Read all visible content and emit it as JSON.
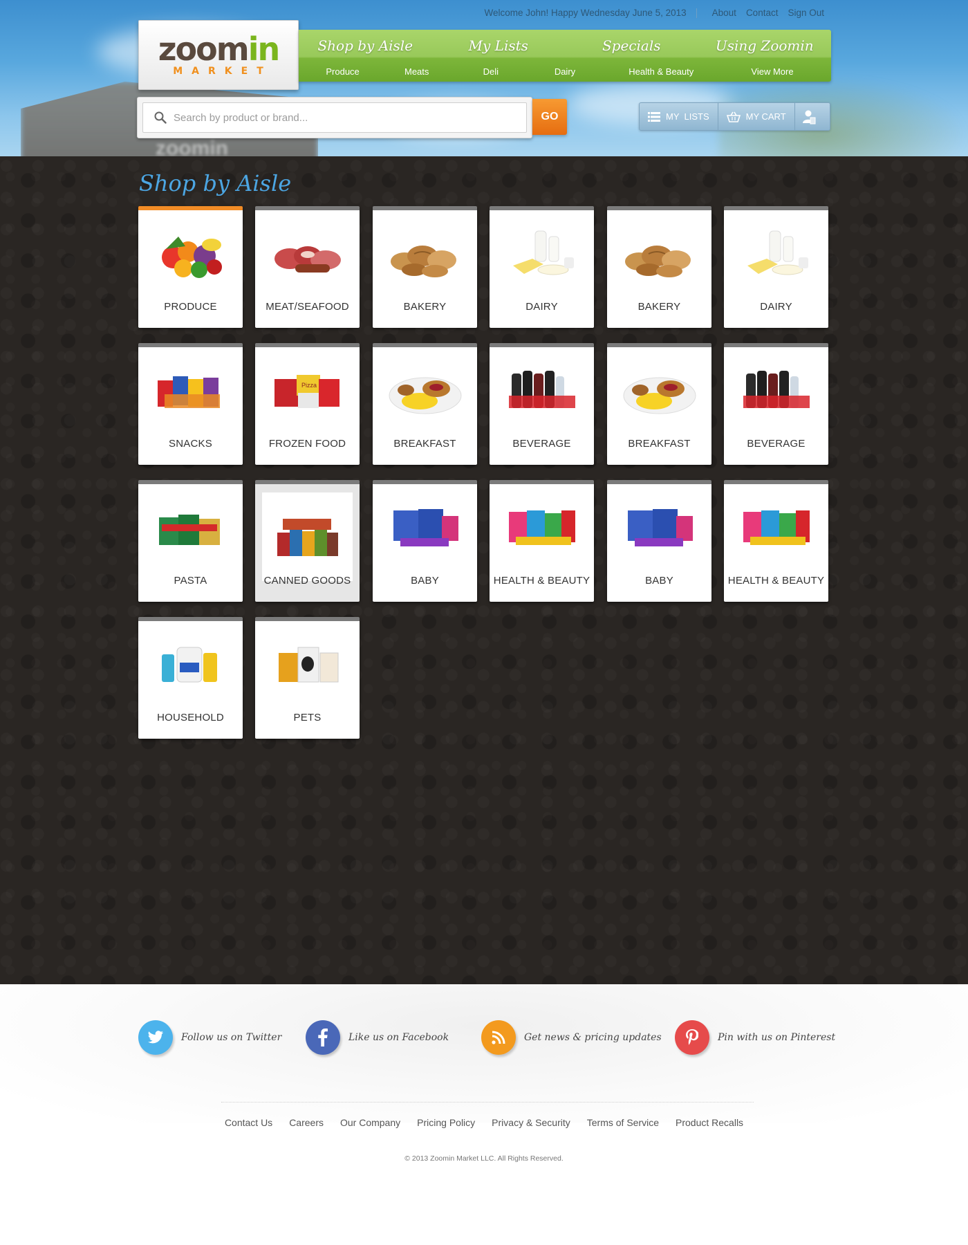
{
  "topbar": {
    "welcome": "Welcome John! Happy Wednesday June 5, 2013",
    "links": [
      "About",
      "Contact",
      "Sign Out"
    ]
  },
  "logo": {
    "word_main": "zoom",
    "word_accent": "in",
    "sub": "MARKET",
    "colors": {
      "brown": "#5a4a3e",
      "green": "#7ab51d",
      "orange": "#f0901e"
    }
  },
  "nav": {
    "primary": [
      "Shop by Aisle",
      "My Lists",
      "Specials",
      "Using Zoomin"
    ],
    "secondary": [
      "Produce",
      "Meats",
      "Deli",
      "Dairy",
      "Health & Beauty",
      "View More"
    ]
  },
  "search": {
    "placeholder": "Search by product or brand...",
    "go_label": "GO",
    "icon": "search-icon"
  },
  "utility": {
    "lists_label": "MY  LISTS",
    "cart_label": "MY CART",
    "lists_icon": "list-icon",
    "cart_icon": "basket-icon",
    "account_icon": "user-icon"
  },
  "main": {
    "title": "Shop by Aisle",
    "tiles": [
      {
        "label": "PRODUCE",
        "art": "produce",
        "state": "active"
      },
      {
        "label": "MEAT/SEAFOOD",
        "art": "meat"
      },
      {
        "label": "BAKERY",
        "art": "bakery"
      },
      {
        "label": "DAIRY",
        "art": "dairy"
      },
      {
        "label": "BAKERY",
        "art": "bakery"
      },
      {
        "label": "DAIRY",
        "art": "dairy"
      },
      {
        "label": "SNACKS",
        "art": "snacks"
      },
      {
        "label": "FROZEN FOOD",
        "art": "frozen"
      },
      {
        "label": "BREAKFAST",
        "art": "breakfast"
      },
      {
        "label": "BEVERAGE",
        "art": "beverage"
      },
      {
        "label": "BREAKFAST",
        "art": "breakfast"
      },
      {
        "label": "BEVERAGE",
        "art": "beverage"
      },
      {
        "label": "PASTA",
        "art": "pasta"
      },
      {
        "label": "CANNED GOODS",
        "art": "canned",
        "state": "hover"
      },
      {
        "label": "BABY",
        "art": "baby"
      },
      {
        "label": "HEALTH & BEAUTY",
        "art": "health"
      },
      {
        "label": "BABY",
        "art": "baby"
      },
      {
        "label": "HEALTH & BEAUTY",
        "art": "health"
      },
      {
        "label": "HOUSEHOLD",
        "art": "household"
      },
      {
        "label": "PETS",
        "art": "pets"
      }
    ]
  },
  "footer": {
    "social": [
      {
        "text": "Follow us on Twitter",
        "icon": "twitter-icon",
        "color": "#4cb3ec"
      },
      {
        "text": "Like us on Facebook",
        "icon": "facebook-icon",
        "color": "#4a68b8"
      },
      {
        "text": "Get news & pricing updates",
        "icon": "rss-icon",
        "color": "#f39a1e"
      },
      {
        "text": "Pin with us on Pinterest",
        "icon": "pinterest-icon",
        "color": "#e64b4b"
      }
    ],
    "links": [
      "Contact Us",
      "Careers",
      "Our Company",
      "Pricing Policy",
      "Privacy & Security",
      "Terms of Service",
      "Product Recalls"
    ],
    "copyright": "© 2013 Zoomin Market LLC. All Rights Reserved."
  }
}
